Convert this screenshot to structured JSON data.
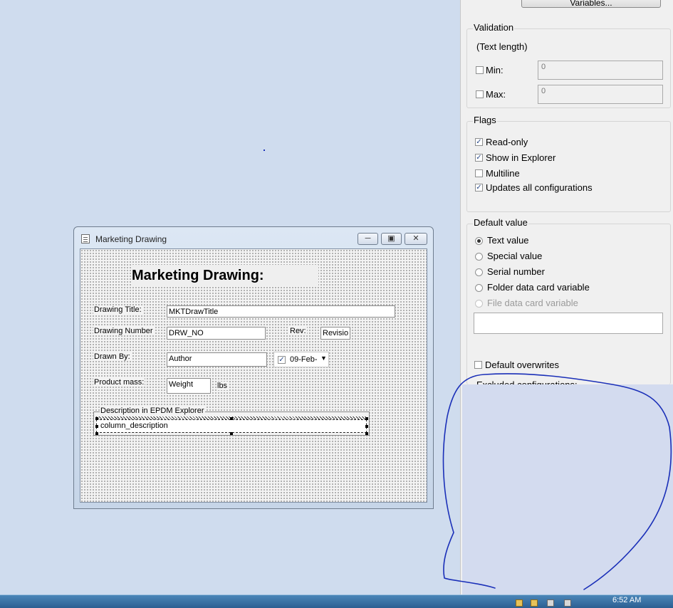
{
  "properties": {
    "variables_button": "Variables...",
    "validation": {
      "title": "Validation",
      "subtitle": "(Text length)",
      "min_label": "Min:",
      "min_value": "0",
      "max_label": "Max:",
      "max_value": "0",
      "min_checked": false,
      "max_checked": false
    },
    "flags": {
      "title": "Flags",
      "items": [
        {
          "label": "Read-only",
          "checked": true
        },
        {
          "label": "Show in Explorer",
          "checked": true
        },
        {
          "label": "Multiline",
          "checked": false
        },
        {
          "label": "Updates all configurations",
          "checked": true
        }
      ]
    },
    "default_value": {
      "title": "Default value",
      "options": [
        {
          "label": "Text value",
          "selected": true,
          "disabled": false
        },
        {
          "label": "Special value",
          "selected": false,
          "disabled": false
        },
        {
          "label": "Serial number",
          "selected": false,
          "disabled": false
        },
        {
          "label": "Folder data card variable",
          "selected": false,
          "disabled": false
        },
        {
          "label": "File data card variable",
          "selected": false,
          "disabled": true
        }
      ],
      "value": "",
      "overwrites_label": "Default overwrites",
      "overwrites_checked": false
    },
    "excluded_label": "Excluded configurations:"
  },
  "window": {
    "title": "Marketing Drawing",
    "heading": "Marketing Drawing:",
    "fields": {
      "drawing_title_label": "Drawing Title:",
      "drawing_title_value": "MKTDrawTitle",
      "drawing_number_label": "Drawing Number",
      "drawing_number_value": "DRW_NO",
      "rev_label": "Rev:",
      "rev_value": "Revisio",
      "drawn_by_label": "Drawn By:",
      "drawn_by_value": "Author",
      "date_value": "09-Feb-",
      "date_checked": true,
      "mass_label": "Product mass:",
      "mass_value": "Weight",
      "mass_unit": "lbs",
      "description_group": "Description in EPDM Explorer",
      "description_value": "column_description"
    }
  },
  "taskbar": {
    "clock": "6:52 AM"
  },
  "colors": {
    "desktop": "#cfdcee",
    "annotation_ink": "#1a2fb8"
  }
}
